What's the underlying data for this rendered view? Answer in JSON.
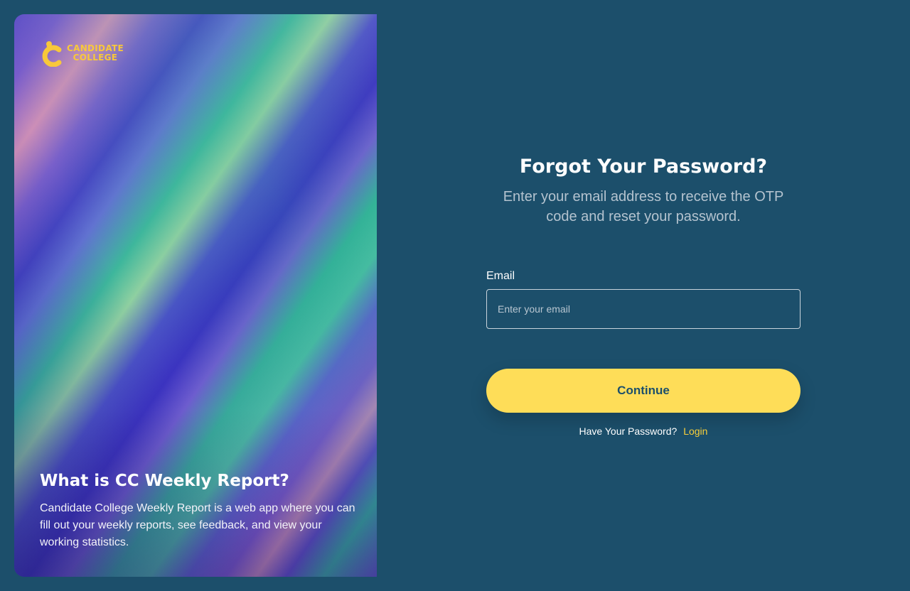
{
  "hero": {
    "logo": {
      "line1": "CANDIDATE",
      "line2": "COLLEGE"
    },
    "title": "What is CC Weekly Report?",
    "description": "Candidate College Weekly Report is a web app where you can fill out your weekly reports, see feedback, and view your working statistics."
  },
  "form": {
    "title": "Forgot Your Password?",
    "subtitle": "Enter your email address to receive the OTP code and reset your password.",
    "email_label": "Email",
    "email_placeholder": "Enter your email",
    "email_value": "",
    "continue_label": "Continue",
    "have_password_text": "Have Your Password?",
    "login_label": "Login"
  },
  "colors": {
    "background": "#1c4f6b",
    "accent": "#fedd58",
    "link": "#f8cf3a",
    "logo": "#f8c83a"
  },
  "icons": {
    "logo": "candidate-college-logo-icon"
  }
}
